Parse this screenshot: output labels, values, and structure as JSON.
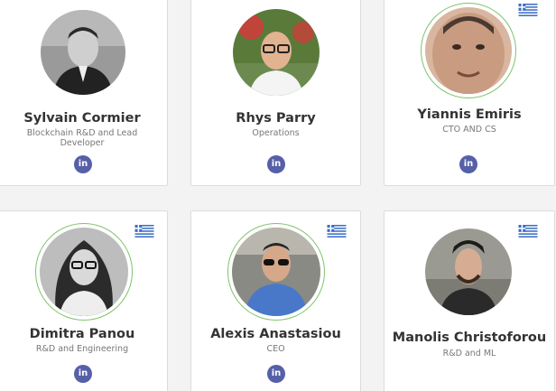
{
  "team": [
    {
      "name": "Sylvain Cormier",
      "role": "Blockchain R&D and Lead Developer",
      "linkedin": "in"
    },
    {
      "name": "Rhys Parry",
      "role": "Operations",
      "linkedin": "in"
    },
    {
      "name": "Yiannis Emiris",
      "role": "CTO AND CS",
      "linkedin": "in",
      "flag": "greece-flag"
    },
    {
      "name": "Dimitra Panou",
      "role": "R&D and Engineering",
      "linkedin": "in",
      "flag": "greece-flag"
    },
    {
      "name": "Alexis Anastasiou",
      "role": "CEO",
      "linkedin": "in",
      "flag": "greece-flag"
    },
    {
      "name": "Manolis Christoforou",
      "role": "R&D and ML",
      "flag": "greece-flag"
    }
  ],
  "colors": {
    "linkedin": "#5560a8",
    "ring": "#7fc36a",
    "flag_blue": "#3d6fc4"
  }
}
